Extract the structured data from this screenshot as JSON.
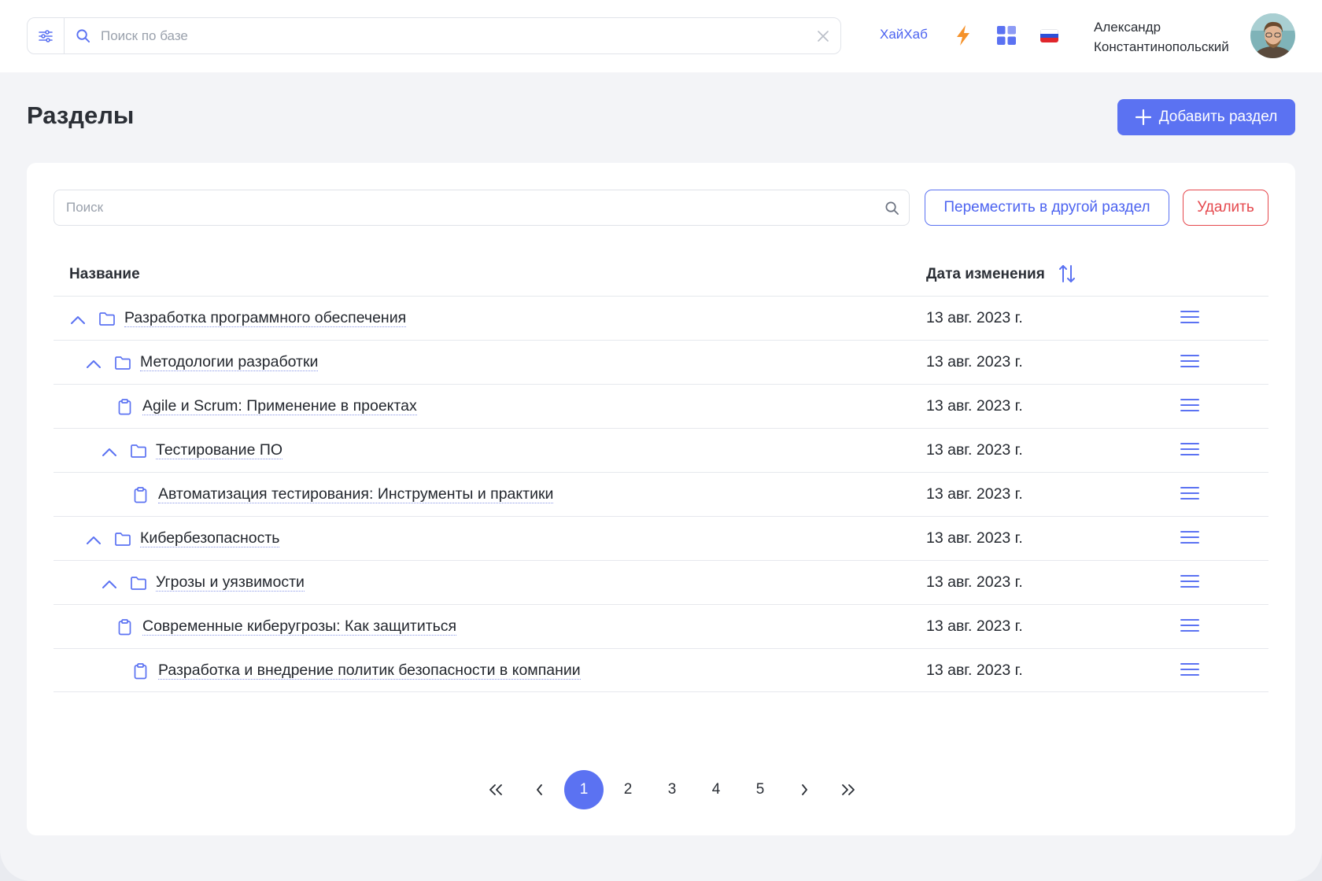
{
  "header": {
    "search_placeholder": "Поиск по базе",
    "hub_link": "ХайХаб",
    "user_name_line1": "Александр",
    "user_name_line2": "Константинопольский"
  },
  "page": {
    "title": "Разделы",
    "add_button": "Добавить раздел"
  },
  "card": {
    "search_placeholder": "Поиск",
    "move_button": "Переместить в другой раздел",
    "delete_button": "Удалить"
  },
  "table": {
    "col_name": "Название",
    "col_date": "Дата изменения",
    "rows": [
      {
        "type": "folder",
        "level": 0,
        "title": "Разработка программного обеспечения",
        "date": "13 авг. 2023 г."
      },
      {
        "type": "folder",
        "level": 1,
        "title": "Методологии разработки",
        "date": "13 авг. 2023 г."
      },
      {
        "type": "doc",
        "level": 1,
        "title": "Agile и Scrum: Применение в проектах",
        "date": "13 авг. 2023 г."
      },
      {
        "type": "folder",
        "level": 2,
        "title": "Тестирование ПО",
        "date": "13 авг. 2023 г."
      },
      {
        "type": "doc",
        "level": 2,
        "title": "Автоматизация тестирования: Инструменты и практики",
        "date": "13 авг. 2023 г."
      },
      {
        "type": "folder",
        "level": 1,
        "title": "Кибербезопасность",
        "date": "13 авг. 2023 г."
      },
      {
        "type": "folder",
        "level": 2,
        "title": "Угрозы и уязвимости",
        "date": "13 авг. 2023 г."
      },
      {
        "type": "doc",
        "level": 1,
        "title": "Современные киберугрозы: Как защититься",
        "date": "13 авг. 2023 г."
      },
      {
        "type": "doc",
        "level": 2,
        "title": "Разработка и внедрение политик безопасности в компании",
        "date": "13 авг. 2023 г."
      }
    ]
  },
  "pagination": {
    "pages": [
      "1",
      "2",
      "3",
      "4",
      "5"
    ],
    "current": "1"
  },
  "colors": {
    "accent": "#5b72f2",
    "danger": "#e5484d",
    "bolt": "#f5922a"
  }
}
